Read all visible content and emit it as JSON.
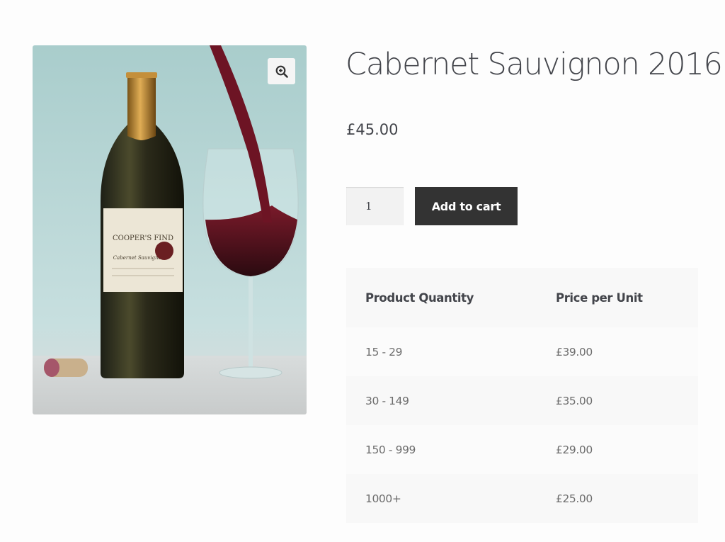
{
  "product": {
    "title": "Cabernet Sauvignon 2016",
    "price": "£45.00",
    "image_icon": "zoom-in-icon",
    "image_label": {
      "brand": "COOPER'S FIND",
      "line1": "Cabernet Sauvignon"
    }
  },
  "cart": {
    "quantity": "1",
    "add_label": "Add to cart"
  },
  "tier_table": {
    "headers": [
      "Product Quantity",
      "Price per Unit"
    ],
    "rows": [
      [
        "15 - 29",
        "£39.00"
      ],
      [
        "30 - 149",
        "£35.00"
      ],
      [
        "150 - 999",
        "£29.00"
      ],
      [
        "1000+",
        "£25.00"
      ]
    ]
  },
  "colors": {
    "button_bg": "#333333",
    "text": "#43454b",
    "wine": "#5a0f1d"
  }
}
